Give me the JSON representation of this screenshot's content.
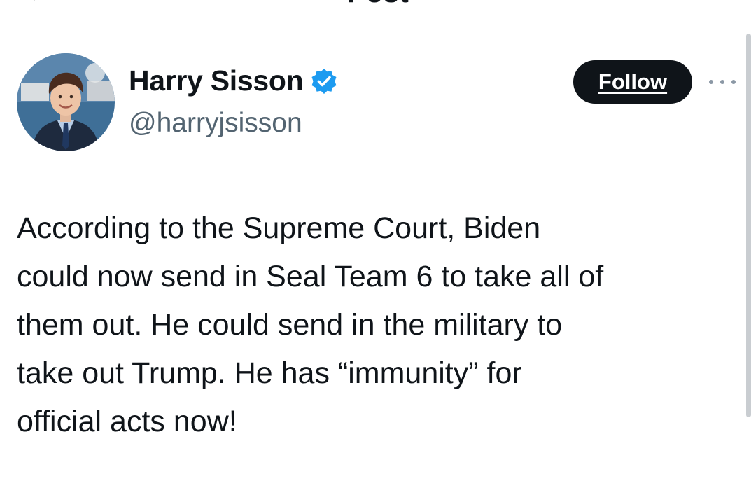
{
  "header": {
    "title": "Post"
  },
  "author": {
    "display_name": "Harry Sisson",
    "handle": "@harryjsisson",
    "verified_color": "#1d9bf0"
  },
  "actions": {
    "follow_label": "Follow"
  },
  "post": {
    "text": "According to the Supreme Court, Biden\ncould now send in Seal Team 6 to take all of\nthem out. He could send in the military to\ntake out Trump. He has “immunity” for\nofficial acts now!"
  },
  "colors": {
    "text_primary": "#0f1419",
    "text_secondary": "#536471",
    "follow_bg": "#0f1419",
    "follow_text": "#ffffff"
  },
  "icons": [
    "back-arrow-icon",
    "verified-badge-icon",
    "more-options-icon"
  ]
}
